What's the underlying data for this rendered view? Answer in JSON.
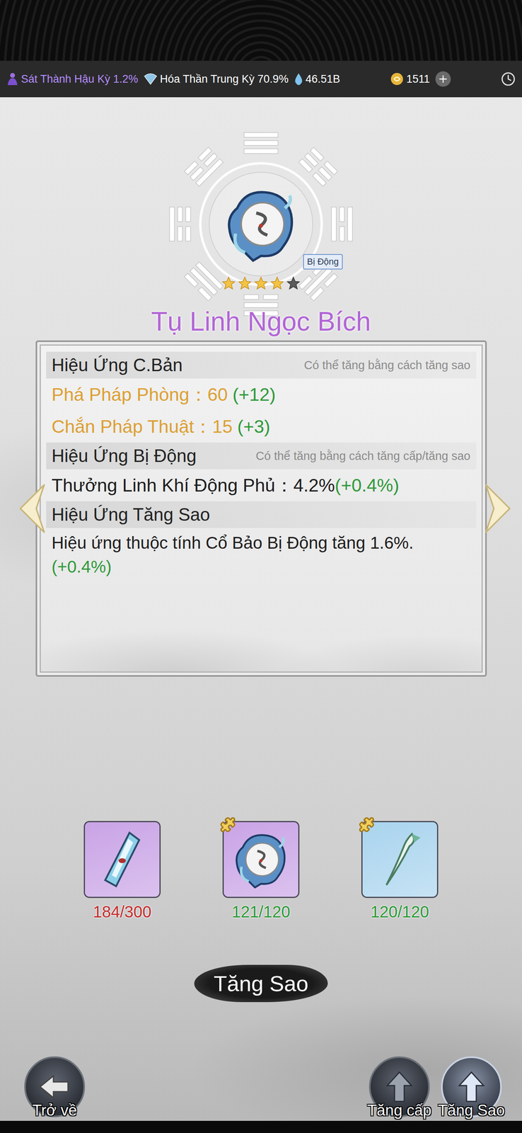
{
  "status_bar": {
    "realm": "Sát Thành Hậu Kỳ 1.2%",
    "cultivation": "Hóa Thần Trung Kỳ 70.9%",
    "spirit_stones": "46.51B",
    "coins": "1511"
  },
  "artifact": {
    "name": "Tụ Linh Ngọc Bích",
    "badge": "Bị Động",
    "stars": 4,
    "max_stars": 5
  },
  "sections": [
    {
      "title": "Hiệu Ứng C.Bản",
      "hint": "Có thể tăng bằng cách tăng sao",
      "lines": [
        {
          "kind": "stat",
          "label": "Phá Pháp Phòng：",
          "value": "60",
          "bonus": "(+12)"
        },
        {
          "kind": "stat",
          "label": "Chắn Pháp Thuật：",
          "value": "15",
          "bonus": "(+3)"
        }
      ]
    },
    {
      "title": "Hiệu Ứng Bị Động",
      "hint": "Có thể tăng bằng cách tăng cấp/tăng sao",
      "lines": [
        {
          "kind": "passive",
          "label": "Thưởng Linh Khí Động Phủ：",
          "value": "4.2%",
          "bonus": "(+0.4%)"
        }
      ]
    },
    {
      "title": "Hiệu Ứng Tăng Sao",
      "hint": "",
      "lines": [
        {
          "kind": "desc",
          "label": "Hiệu ứng thuộc tính Cổ Bảo Bị Động tăng ",
          "value": "1.6%.",
          "bonus": "(+0.4%)"
        }
      ]
    }
  ],
  "materials": [
    {
      "kind": "shard",
      "count": "184/300",
      "enough": false,
      "fragment": false,
      "color": "#c9a3e6"
    },
    {
      "kind": "artifact",
      "count": "121/120",
      "enough": true,
      "fragment": true,
      "color": "#c9a3e6"
    },
    {
      "kind": "blade",
      "count": "120/120",
      "enough": true,
      "fragment": true,
      "color": "#a9d4ee"
    }
  ],
  "upgrade_button": "Tăng Sao",
  "nav": {
    "back": "Trở về",
    "tabs": [
      {
        "label": "Tăng cấp",
        "selected": false
      },
      {
        "label": "Tăng Sao",
        "selected": true
      }
    ]
  }
}
